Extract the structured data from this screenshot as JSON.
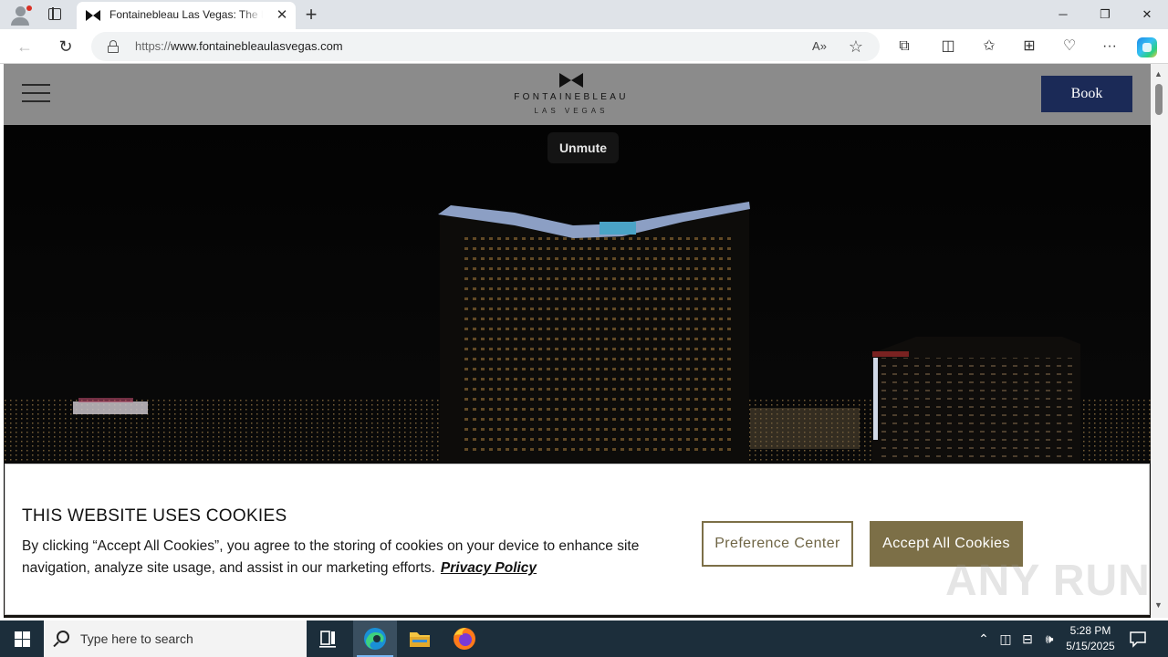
{
  "browser": {
    "tab_title": "Fontainebleau Las Vegas: The Best",
    "tab_close": "✕",
    "new_tab": "+",
    "url_scheme": "https://",
    "url_domain": "www.fontainebleaulasvegas.com",
    "window_controls": {
      "minimize": "─",
      "restore": "❐",
      "close": "✕"
    },
    "nav": {
      "back": "←",
      "reload": "↻"
    },
    "omnibox_icons": {
      "read_aloud": "A»",
      "favorite": "☆"
    },
    "toolbar_icons": {
      "extensions": "⧉",
      "split": "◫",
      "favorites": "✩",
      "collections": "⊞",
      "performance": "♡",
      "more": "···"
    }
  },
  "site": {
    "logo_name": "FONTAINEBLEAU",
    "logo_sub": "LAS VEGAS",
    "book_label": "Book",
    "unmute_label": "Unmute"
  },
  "cookie": {
    "title": "THIS WEBSITE USES COOKIES",
    "message": "By clicking “Accept All Cookies”, you agree to the storing of cookies on your device to enhance site navigation, analyze site usage, and assist in our marketing efforts.",
    "policy_link": "Privacy Policy",
    "preference_label": "Preference Center",
    "accept_label": "Accept All Cookies",
    "watermark": "ANY RUN"
  },
  "taskbar": {
    "search_placeholder": "Type here to search",
    "time": "5:28 PM",
    "date": "5/15/2025"
  }
}
